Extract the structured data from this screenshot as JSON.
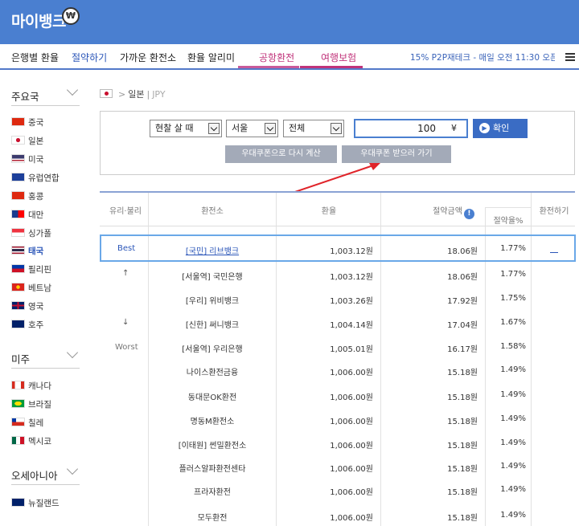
{
  "header": {
    "logo": "마이뱅크",
    "badge": "₩"
  },
  "nav": {
    "items": [
      "은행별 환율",
      "절약하기",
      "가까운 환전소",
      "환율 알리미",
      "공항환전",
      "여행보험"
    ],
    "ticker": "15% P2P재테크 - 매일 오전 11:30 오픈"
  },
  "sidebar": {
    "regions": [
      {
        "title": "주요국",
        "countries": [
          "중국",
          "일본",
          "미국",
          "유럽연합",
          "홍콩",
          "대만",
          "싱가폴",
          "태국",
          "필리핀",
          "베트남",
          "영국",
          "호주"
        ]
      },
      {
        "title": "미주",
        "countries": [
          "캐나다",
          "브라질",
          "칠레",
          "멕시코"
        ]
      },
      {
        "title": "오세아니아",
        "countries": [
          "뉴질랜드"
        ]
      }
    ]
  },
  "breadcrumb": {
    "country": "일본",
    "code": "JPY"
  },
  "filter": {
    "type": "현찰 살 때",
    "city": "서울",
    "area": "전체",
    "amount": "100",
    "amount_unit": "¥",
    "confirm": "확인",
    "recalc": "우대쿠폰으로 다시 계산",
    "coupon": "우대쿠폰 받으러 가기"
  },
  "table": {
    "headers": {
      "rank": "유리·불리",
      "shop": "환전소",
      "rate": "환율",
      "saving": "절약금액",
      "saving_pct": "절약율%",
      "exchange": "환전하기"
    },
    "side_labels": {
      "best": "Best",
      "up": "↑",
      "down": "↓",
      "worst": "Worst"
    },
    "rows": [
      {
        "shop": "[국민] 리브뱅크",
        "rate": "1,003.12원",
        "saving": "18.06원",
        "pct": "1.77%"
      },
      {
        "shop": "[서울역] 국민은행",
        "rate": "1,003.12원",
        "saving": "18.06원",
        "pct": "1.77%"
      },
      {
        "shop": "[우리] 위비뱅크",
        "rate": "1,003.26원",
        "saving": "17.92원",
        "pct": "1.75%"
      },
      {
        "shop": "[신한] 써니뱅크",
        "rate": "1,004.14원",
        "saving": "17.04원",
        "pct": "1.67%"
      },
      {
        "shop": "[서울역] 우리은행",
        "rate": "1,005.01원",
        "saving": "16.17원",
        "pct": "1.58%"
      },
      {
        "shop": "나이스환전금융",
        "rate": "1,006.00원",
        "saving": "15.18원",
        "pct": "1.49%"
      },
      {
        "shop": "동대문OK환전",
        "rate": "1,006.00원",
        "saving": "15.18원",
        "pct": "1.49%"
      },
      {
        "shop": "명동M환전소",
        "rate": "1,006.00원",
        "saving": "15.18원",
        "pct": "1.49%"
      },
      {
        "shop": "[이태원] 썬밀환전소",
        "rate": "1,006.00원",
        "saving": "15.18원",
        "pct": "1.49%"
      },
      {
        "shop": "플러스알파환전센타",
        "rate": "1,006.00원",
        "saving": "15.18원",
        "pct": "1.49%"
      },
      {
        "shop": "프라자환전",
        "rate": "1,006.00원",
        "saving": "15.18원",
        "pct": "1.49%"
      },
      {
        "shop": "모두환전",
        "rate": "1,006.00원",
        "saving": "15.18원",
        "pct": "1.49%"
      }
    ]
  }
}
